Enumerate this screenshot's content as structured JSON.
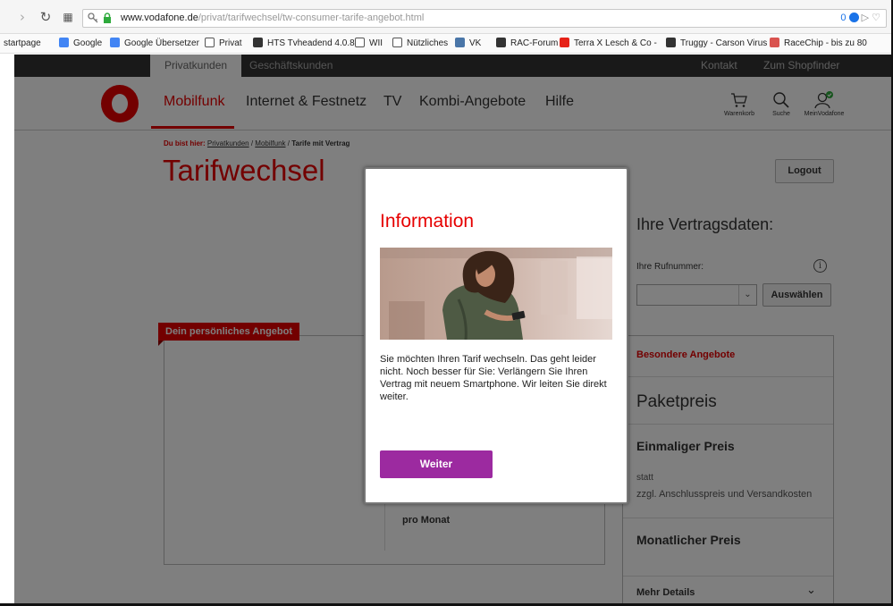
{
  "browser": {
    "url_domain": "www.vodafone.de",
    "url_path": "/privat/tarifwechsel/tw-consumer-tarife-angebot.html",
    "addon_badge": "0",
    "bookmarks": [
      {
        "label": "startpage",
        "color": "#ffffff"
      },
      {
        "label": "Google",
        "color": "#4285f4"
      },
      {
        "label": "Google Übersetzer",
        "color": "#4285f4"
      },
      {
        "label": "Privat",
        "color": "#ffffff"
      },
      {
        "label": "HTS Tvheadend 4.0.8",
        "color": "#333333"
      },
      {
        "label": "WII",
        "color": "#ffffff"
      },
      {
        "label": "Nützliches",
        "color": "#ffffff"
      },
      {
        "label": "VK",
        "color": "#4a76a8"
      },
      {
        "label": "RAC-Forum",
        "color": "#333333"
      },
      {
        "label": "Terra X Lesch & Co -",
        "color": "#e62117"
      },
      {
        "label": "Truggy - Carson Virus",
        "color": "#333333"
      },
      {
        "label": "RaceChip - bis zu 80",
        "color": "#d9534f"
      }
    ]
  },
  "topnav": {
    "tab_private": "Privatkunden",
    "tab_business": "Geschäftskunden",
    "contact": "Kontakt",
    "shopfinder": "Zum Shopfinder"
  },
  "mainnav": {
    "items": [
      "Mobilfunk",
      "Internet & Festnetz",
      "TV",
      "Kombi-Angebote",
      "Hilfe"
    ],
    "cart": "Warenkorb",
    "search": "Suche",
    "account": "MeinVodafone"
  },
  "breadcrumb": {
    "label": "Du bist hier:",
    "items": [
      "Privatkunden",
      "Mobilfunk",
      "Tarife mit Vertrag"
    ]
  },
  "page": {
    "title": "Tarifwechsel",
    "logout": "Logout",
    "contract_title": "Ihre Vertragsdaten:",
    "phone_label": "Ihre Rufnummer:",
    "select_button": "Auswählen",
    "offer_tag": "Dein persönliches Angebot",
    "per_month": "pro Monat",
    "special_offers": "Besondere Angebote",
    "package_price": "Paketpreis",
    "one_time_price": "Einmaliger Preis",
    "instead": "statt",
    "extra_costs": "zzgl. Anschlusspreis und Versandkosten",
    "monthly_price": "Monatlicher Preis",
    "more_details": "Mehr Details"
  },
  "modal": {
    "title": "Information",
    "text": "Sie möchten Ihren Tarif wechseln. Das geht leider nicht. Noch besser für Sie: Verlängern Sie Ihren Vertrag mit neuem Smartphone. Wir leiten Sie direkt weiter.",
    "button": "Weiter"
  },
  "colors": {
    "brand_red": "#e60000",
    "button_purple": "#9c2aa0"
  }
}
